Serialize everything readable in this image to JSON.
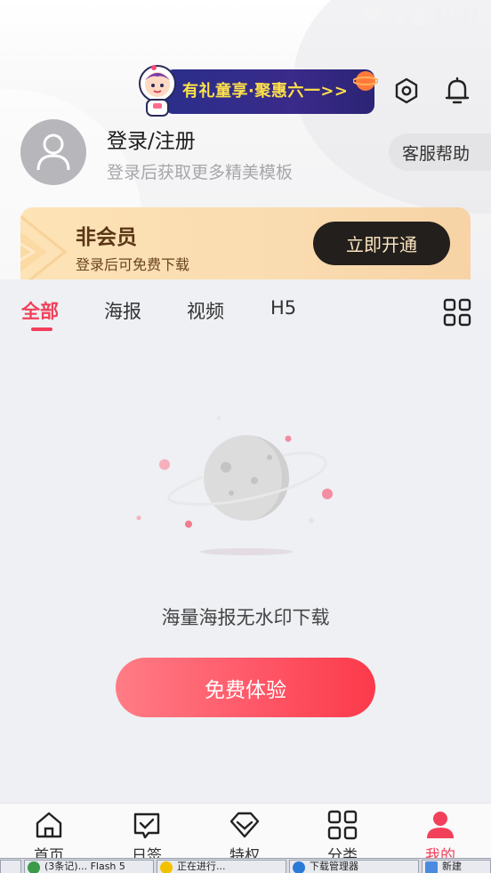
{
  "status_bar": {
    "time": "11:47"
  },
  "promo": {
    "text": "有礼童享·聚惠六一>>"
  },
  "user": {
    "title": "登录/注册",
    "subtitle": "登录后获取更多精美模板"
  },
  "help_button": "客服帮助",
  "member": {
    "title": "非会员",
    "subtitle": "登录后可免费下载",
    "button": "立即开通"
  },
  "tabs": [
    {
      "label": "全部"
    },
    {
      "label": "海报"
    },
    {
      "label": "视频"
    },
    {
      "label": "H5"
    }
  ],
  "empty": {
    "text": "海量海报无水印下载",
    "cta": "免费体验"
  },
  "nav": [
    {
      "label": "首页",
      "icon": "home-icon"
    },
    {
      "label": "日签",
      "icon": "calendar-check-icon"
    },
    {
      "label": "特权",
      "icon": "diamond-icon"
    },
    {
      "label": "分类",
      "icon": "grid-icon"
    },
    {
      "label": "我的",
      "icon": "user-icon"
    }
  ],
  "taskbar": [
    {
      "label": "(3条记)... Flash 5"
    },
    {
      "label": "正在进行..."
    },
    {
      "label": "下载管理器"
    },
    {
      "label": "新建"
    }
  ],
  "colors": {
    "accent": "#f2405a",
    "member_text": "#5a3516",
    "cta_start": "#ff7c85",
    "cta_end": "#fb3a4a"
  }
}
